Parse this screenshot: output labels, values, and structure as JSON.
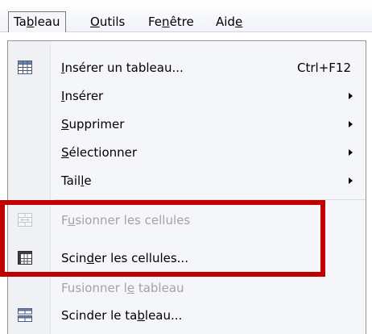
{
  "menubar": {
    "items": [
      {
        "label_pre": "Ta",
        "label_ul": "b",
        "label_post": "leau"
      },
      {
        "label_pre": "",
        "label_ul": "O",
        "label_post": "utils"
      },
      {
        "label_pre": "Fe",
        "label_ul": "n",
        "label_post": "être"
      },
      {
        "label_pre": "Aid",
        "label_ul": "e",
        "label_post": ""
      }
    ]
  },
  "menu": {
    "items": [
      {
        "pre": "",
        "ul": "I",
        "post": "nsérer un tableau...",
        "shortcut": "Ctrl+F12",
        "icon": "insert-table-icon"
      },
      {
        "pre": "",
        "ul": "I",
        "post": "nsérer",
        "submenu": true
      },
      {
        "pre": "",
        "ul": "S",
        "post": "upprimer",
        "submenu": true
      },
      {
        "pre": "",
        "ul": "S",
        "post": "électionner",
        "submenu": true
      },
      {
        "pre": "Tail",
        "ul": "l",
        "post": "e",
        "submenu": true
      },
      {
        "pre": "F",
        "ul": "u",
        "post": "sionner les cellules",
        "disabled": true,
        "icon": "merge-cells-icon"
      },
      {
        "pre": "Scin",
        "ul": "d",
        "post": "er les cellules...",
        "icon": "split-cells-icon"
      },
      {
        "pre": "Fusionner l",
        "ul": "e",
        "post": " tableau",
        "disabled": true
      },
      {
        "pre": "Scinder le ta",
        "ul": "b",
        "post": "leau...",
        "icon": "split-table-icon"
      }
    ]
  },
  "colors": {
    "highlight": "#c00000",
    "disabled_text": "#a3a3a3"
  }
}
